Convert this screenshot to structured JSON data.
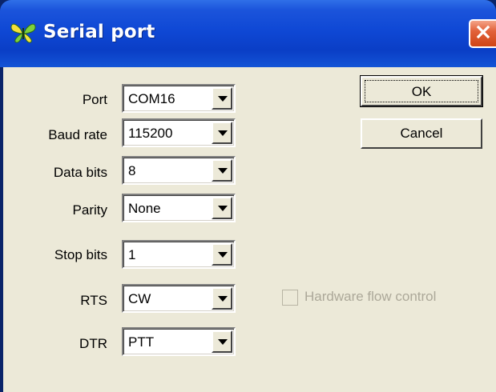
{
  "window": {
    "title": "Serial port",
    "icon": "butterfly-icon",
    "close_icon": "close-icon"
  },
  "fields": {
    "port": {
      "label": "Port",
      "value": "COM16"
    },
    "baud": {
      "label": "Baud rate",
      "value": "115200"
    },
    "databits": {
      "label": "Data bits",
      "value": "8"
    },
    "parity": {
      "label": "Parity",
      "value": "None"
    },
    "stopbits": {
      "label": "Stop bits",
      "value": "1"
    },
    "rts": {
      "label": "RTS",
      "value": "CW"
    },
    "dtr": {
      "label": "DTR",
      "value": "PTT"
    }
  },
  "buttons": {
    "ok": "OK",
    "cancel": "Cancel"
  },
  "hardware_flow": {
    "label": "Hardware flow control",
    "checked": false,
    "enabled": false
  },
  "colors": {
    "title_bar": "#0a3ec6",
    "close_button": "#e2623a",
    "dialog_face": "#ece9d8",
    "disabled_text": "#aca899"
  }
}
